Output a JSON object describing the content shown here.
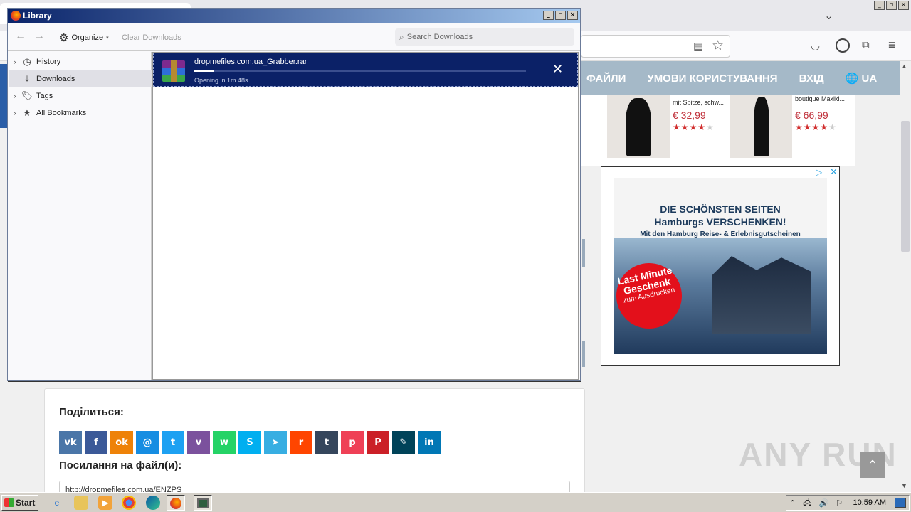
{
  "browser": {
    "nav_links": [
      "ФАЙЛИ",
      "УМОВИ КОРИСТУВАННЯ",
      "ВХІД",
      "UA"
    ],
    "window_controls": [
      "_",
      "▫",
      "×"
    ]
  },
  "products": [
    {
      "title": "mit Spitze, schw...",
      "price": "€ 32,99",
      "rating": 4
    },
    {
      "title": "boutique Maxikl...",
      "price": "€ 66,99",
      "rating": 4
    }
  ],
  "ad": {
    "line1": "DIE SCHÖNSTEN SEITEN",
    "line2": "Hamburgs VERSCHENKEN!",
    "line3": "Mit den Hamburg Reise- & Erlebnisgutscheinen",
    "badge_big": "Last Minute Geschenk",
    "badge_small": "zum Ausdrucken"
  },
  "share": {
    "title": "Поділиться:",
    "links_title": "Посилання на файл(и):",
    "link_value": "http://dropmefiles.com.ua/ENZPS",
    "buttons": [
      {
        "name": "vk",
        "glyph": "vk",
        "color": "#4a76a8"
      },
      {
        "name": "facebook",
        "glyph": "f",
        "color": "#3b5998"
      },
      {
        "name": "odnoklassniki",
        "glyph": "ok",
        "color": "#ee8208"
      },
      {
        "name": "moimir",
        "glyph": "@",
        "color": "#168de2"
      },
      {
        "name": "twitter",
        "glyph": "t",
        "color": "#1da1f2"
      },
      {
        "name": "viber",
        "glyph": "v",
        "color": "#7b519d"
      },
      {
        "name": "whatsapp",
        "glyph": "w",
        "color": "#25d366"
      },
      {
        "name": "skype",
        "glyph": "S",
        "color": "#00aff0"
      },
      {
        "name": "telegram",
        "glyph": "➤",
        "color": "#37aee2"
      },
      {
        "name": "reddit",
        "glyph": "r",
        "color": "#ff4500"
      },
      {
        "name": "tumblr",
        "glyph": "t",
        "color": "#35465c"
      },
      {
        "name": "pocket",
        "glyph": "p",
        "color": "#ef4056"
      },
      {
        "name": "pinterest",
        "glyph": "P",
        "color": "#cb2027"
      },
      {
        "name": "livejournal",
        "glyph": "✎",
        "color": "#004359"
      },
      {
        "name": "linkedin",
        "glyph": "in",
        "color": "#0077b5"
      }
    ]
  },
  "watermark": "ANY RUN",
  "library": {
    "title": "Library",
    "toolbar": {
      "organize": "Organize",
      "clear": "Clear Downloads",
      "search_placeholder": "Search Downloads"
    },
    "sidebar": [
      {
        "label": "History",
        "icon": "clock-icon",
        "expandable": true
      },
      {
        "label": "Downloads",
        "icon": "download-icon",
        "expandable": false,
        "selected": true
      },
      {
        "label": "Tags",
        "icon": "tag-icon",
        "expandable": true
      },
      {
        "label": "All Bookmarks",
        "icon": "star-icon",
        "expandable": true
      }
    ],
    "download": {
      "filename": "dropmefiles.com.ua_Grabber.rar",
      "status": "Opening in 1m 48s…",
      "progress": 0.06
    }
  },
  "taskbar": {
    "start": "Start",
    "clock": "10:59 AM"
  }
}
